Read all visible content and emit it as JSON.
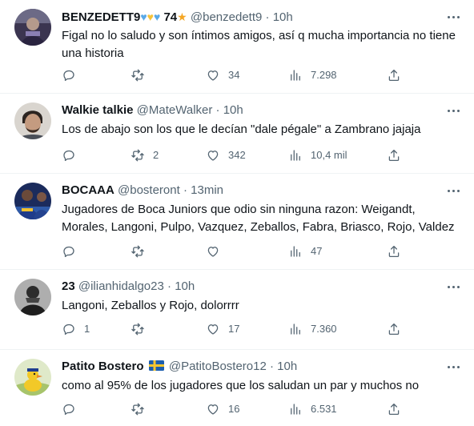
{
  "tweets": [
    {
      "name": "BENZEDETT9",
      "badge": "74",
      "handle": "@benzedett9",
      "dot": "·",
      "time": "10h",
      "text": "Figal no lo saludo y son íntimos amigos, así q mucha importancia no tiene una historia",
      "replies": "",
      "retweets": "",
      "likes": "34",
      "views": "7.298"
    },
    {
      "name": "Walkie talkie",
      "handle": "@MateWalker",
      "dot": "·",
      "time": "10h",
      "text": "Los de abajo son los que le decían \"dale pégale\" a Zambrano jajaja",
      "replies": "",
      "retweets": "2",
      "likes": "342",
      "views": "10,4 mil"
    },
    {
      "name": "BOCAAA",
      "handle": "@bosteront",
      "dot": "·",
      "time": "13min",
      "text": "Jugadores de Boca Juniors que odio sin ninguna razon: Weigandt, Morales, Langoni, Pulpo, Vazquez, Zeballos, Fabra, Briasco, Rojo, Valdez",
      "replies": "",
      "retweets": "",
      "likes": "",
      "views": "47"
    },
    {
      "name": "23",
      "handle": "@ilianhidalgo23",
      "dot": "·",
      "time": "10h",
      "text": "Langoni, Zeballos y Rojo, dolorrrr",
      "replies": "1",
      "retweets": "",
      "likes": "17",
      "views": "7.360"
    },
    {
      "name": "Patito Bostero",
      "handle": "@PatitoBostero12",
      "dot": "·",
      "time": "10h",
      "text": "como al 95% de los jugadores que los saludan un par y muchos no",
      "replies": "",
      "retweets": "",
      "likes": "16",
      "views": "6.531"
    }
  ],
  "icons": {
    "reply": "reply-icon",
    "retweet": "retweet-icon",
    "like": "heart-icon",
    "views": "views-icon",
    "share": "share-icon",
    "more": "more-icon"
  },
  "colors": {
    "text": "#0f1419",
    "secondary": "#536471",
    "divider": "#eff3f4",
    "heart_blue": "#5aa9e6",
    "heart_yellow": "#f5c33b",
    "star": "#f5a623"
  }
}
